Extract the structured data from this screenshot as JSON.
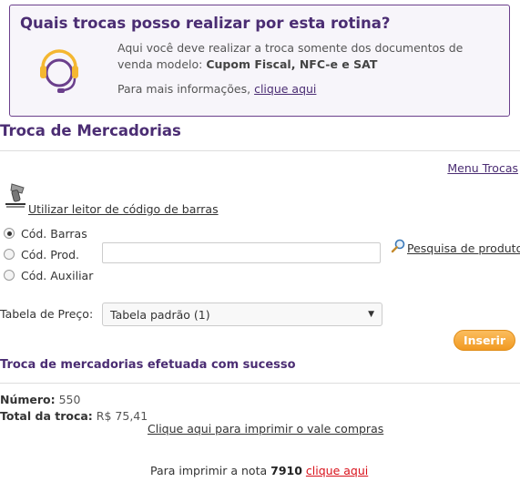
{
  "info": {
    "title": "Quais trocas posso realizar por esta rotina?",
    "text_prefix": "Aqui você deve realizar a troca somente dos documentos de venda modelo: ",
    "text_bold": "Cupom Fiscal, NFC-e e SAT",
    "more_prefix": "Para mais informações, ",
    "more_link": "clique aqui",
    "icon": "headset-icon"
  },
  "section": {
    "title": "Troca de Mercadorias",
    "menu_link": "Menu Trocas"
  },
  "scanner": {
    "label": "Utilizar leitor de código de barras",
    "icon": "barcode-scanner-icon"
  },
  "search": {
    "options": [
      "Cód. Barras",
      "Cód. Prod.",
      "Cód. Auxiliar"
    ],
    "selected": "Cód. Barras",
    "input_value": "",
    "input_placeholder": "",
    "product_search_link": "Pesquisa de produtos"
  },
  "price_table": {
    "label": "Tabela de Preço:",
    "selected": "Tabela padrão (1)"
  },
  "insert_button": "Inserir",
  "result": {
    "title": "Troca de mercadorias efetuada com sucesso",
    "number_label": "Número:",
    "number_value": "550",
    "total_label": "Total da troca:",
    "total_value": "R$ 75,41",
    "print_voucher_link": "Clique aqui para imprimir o vale compras",
    "print_note_prefix": "Para imprimir a nota",
    "note_number": "7910",
    "print_note_link": "clique aqui"
  },
  "colors": {
    "brand_purple": "#4b2d73",
    "accent_orange": "#f19a22",
    "link_red": "#d9121b"
  }
}
